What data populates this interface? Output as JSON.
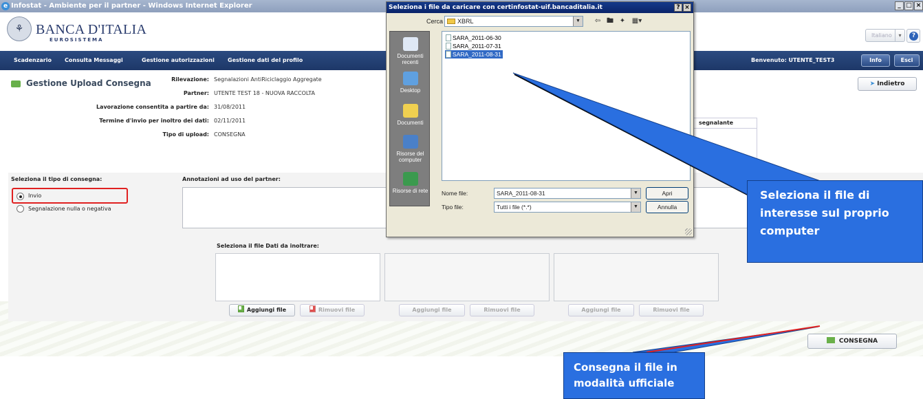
{
  "window": {
    "title": "Infostat - Ambiente per il partner - Windows Internet Explorer",
    "controls": [
      "_",
      "&",
      "×"
    ]
  },
  "header": {
    "bank_name": "BANCA D'ITALIA",
    "bank_sub": "EUROSISTEMA",
    "language": "Italiano"
  },
  "nav": {
    "items": [
      "Scadenzario",
      "Consulta Messaggi",
      "Gestione autorizzazioni",
      "Gestione dati del profilo"
    ],
    "welcome": "Benvenuto:  UTENTE_TEST3",
    "info_label": "Info",
    "exit_label": "Esci"
  },
  "page": {
    "title": "Gestione Upload Consegna",
    "back_label": "Indietro",
    "info": [
      {
        "label": "Rilevazione:",
        "value": "Segnalazioni AntiRiciclaggio Aggregate"
      },
      {
        "label": "Partner:",
        "value": "UTENTE TEST 18 - NUOVA RACCOLTA"
      },
      {
        "label": "Lavorazione consentita a partire da:",
        "value": "31/08/2011"
      },
      {
        "label": "Termine d'invio per inoltro dei dati:",
        "value": "02/11/2011"
      },
      {
        "label": "Tipo di upload:",
        "value": "CONSEGNA"
      }
    ],
    "partial_header": "segnalante",
    "delivery_type_label": "Seleziona il tipo di consegna:",
    "radio_options": [
      "Invio",
      "Segnalazione nulla o negativa"
    ],
    "notes_label": "Annotazioni ad uso del partner:",
    "files_label": "Seleziona il file Dati da inoltrare:",
    "add_file_label": "Aggiungi file",
    "remove_file_label": "Rimuovi file",
    "submit_label": "CONSEGNA"
  },
  "dialog": {
    "title": "Seleziona i file da caricare con certinfostat-uif.bancaditalia.it",
    "help": "?",
    "close": "×",
    "look_in_label": "Cerca in:",
    "look_in_value": "XBRL",
    "places": [
      "Documenti recenti",
      "Desktop",
      "Documenti",
      "Risorse del computer",
      "Risorse di rete"
    ],
    "files": [
      "SARA_2011-06-30",
      "SARA_2011-07-31",
      "SARA_2011-08-31"
    ],
    "selected_index": 2,
    "file_name_label": "Nome file:",
    "file_name_value": "SARA_2011-08-31",
    "file_type_label": "Tipo file:",
    "file_type_value": "Tutti i file (*.*)",
    "open_label": "Apri",
    "cancel_label": "Annulla"
  },
  "callouts": {
    "select_file": "Seleziona il file di interesse sul proprio computer",
    "deliver_file": "Consegna il file in modalità ufficiale"
  },
  "colors": {
    "navbar": "#1d3768",
    "callout": "#2a6fe0",
    "highlight": "#e02020"
  }
}
